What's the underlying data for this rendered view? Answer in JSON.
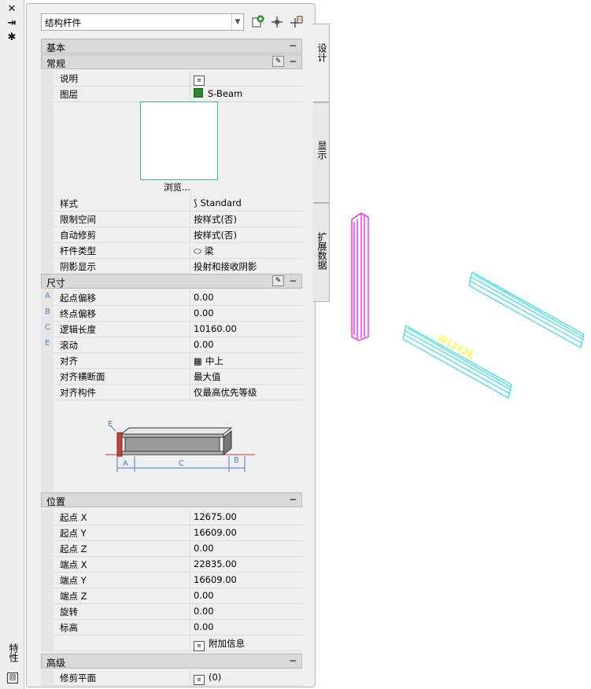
{
  "titlebar": {
    "close": "✕",
    "autohide": "⇥",
    "options": "✱",
    "label": "特性",
    "footer_icon": "回"
  },
  "header": {
    "object_type": "结构杆件",
    "tools": [
      "quick-select-icon",
      "select-objects-icon",
      "pickadd-icon"
    ]
  },
  "sections": {
    "basic": "基本",
    "general": "常规",
    "dimensions": "尺寸",
    "location": "位置",
    "advanced": "高级"
  },
  "general": {
    "description_label": "说明",
    "layer_label": "图层",
    "layer_value": "S-Beam",
    "preview_browse": "浏览...",
    "style_label": "样式",
    "style_value": "Standard",
    "constrain_label": "限制空间",
    "constrain_value": "按样式(否)",
    "autotrim_label": "自动修剪",
    "autotrim_value": "按样式(否)",
    "member_type_label": "杆件类型",
    "member_type_value": "梁",
    "shadow_label": "阴影显示",
    "shadow_value": "投射和接收阴影"
  },
  "dimensions": {
    "start_offset_label": "起点偏移",
    "start_offset_value": "0.00",
    "end_offset_label": "终点偏移",
    "end_offset_value": "0.00",
    "logical_length_label": "逻辑长度",
    "logical_length_value": "10160.00",
    "roll_label": "滚动",
    "roll_value": "0.00",
    "justify_label": "对齐",
    "justify_value": "中上",
    "justify_section_label": "对齐横断面",
    "justify_section_value": "最大值",
    "justify_members_label": "对齐构件",
    "justify_members_value": "仅最高优先等级",
    "letter_a": "A",
    "letter_b": "B",
    "letter_c": "C",
    "letter_e": "E"
  },
  "location": {
    "start_x_label": "起点 X",
    "start_x_value": "12675.00",
    "start_y_label": "起点 Y",
    "start_y_value": "16609.00",
    "start_z_label": "起点 Z",
    "start_z_value": "0.00",
    "end_x_label": "端点 X",
    "end_x_value": "22835.00",
    "end_y_label": "端点 Y",
    "end_y_value": "16609.00",
    "end_z_label": "端点 Z",
    "end_z_value": "0.00",
    "rotation_label": "旋转",
    "rotation_value": "0.00",
    "elevation_label": "标高",
    "elevation_value": "0.00",
    "additional_info": "附加信息"
  },
  "advanced": {
    "trim_planes_label": "修剪平面",
    "trim_planes_value": "(0)"
  },
  "tabs": {
    "design": "设计",
    "display": "显示",
    "extended_data": "扩展数据"
  },
  "drawing": {
    "beam_tag": "W12X26",
    "colors": {
      "selected": "#ff00ff",
      "beam": "#00e0e0",
      "tag": "#ffff00"
    }
  }
}
